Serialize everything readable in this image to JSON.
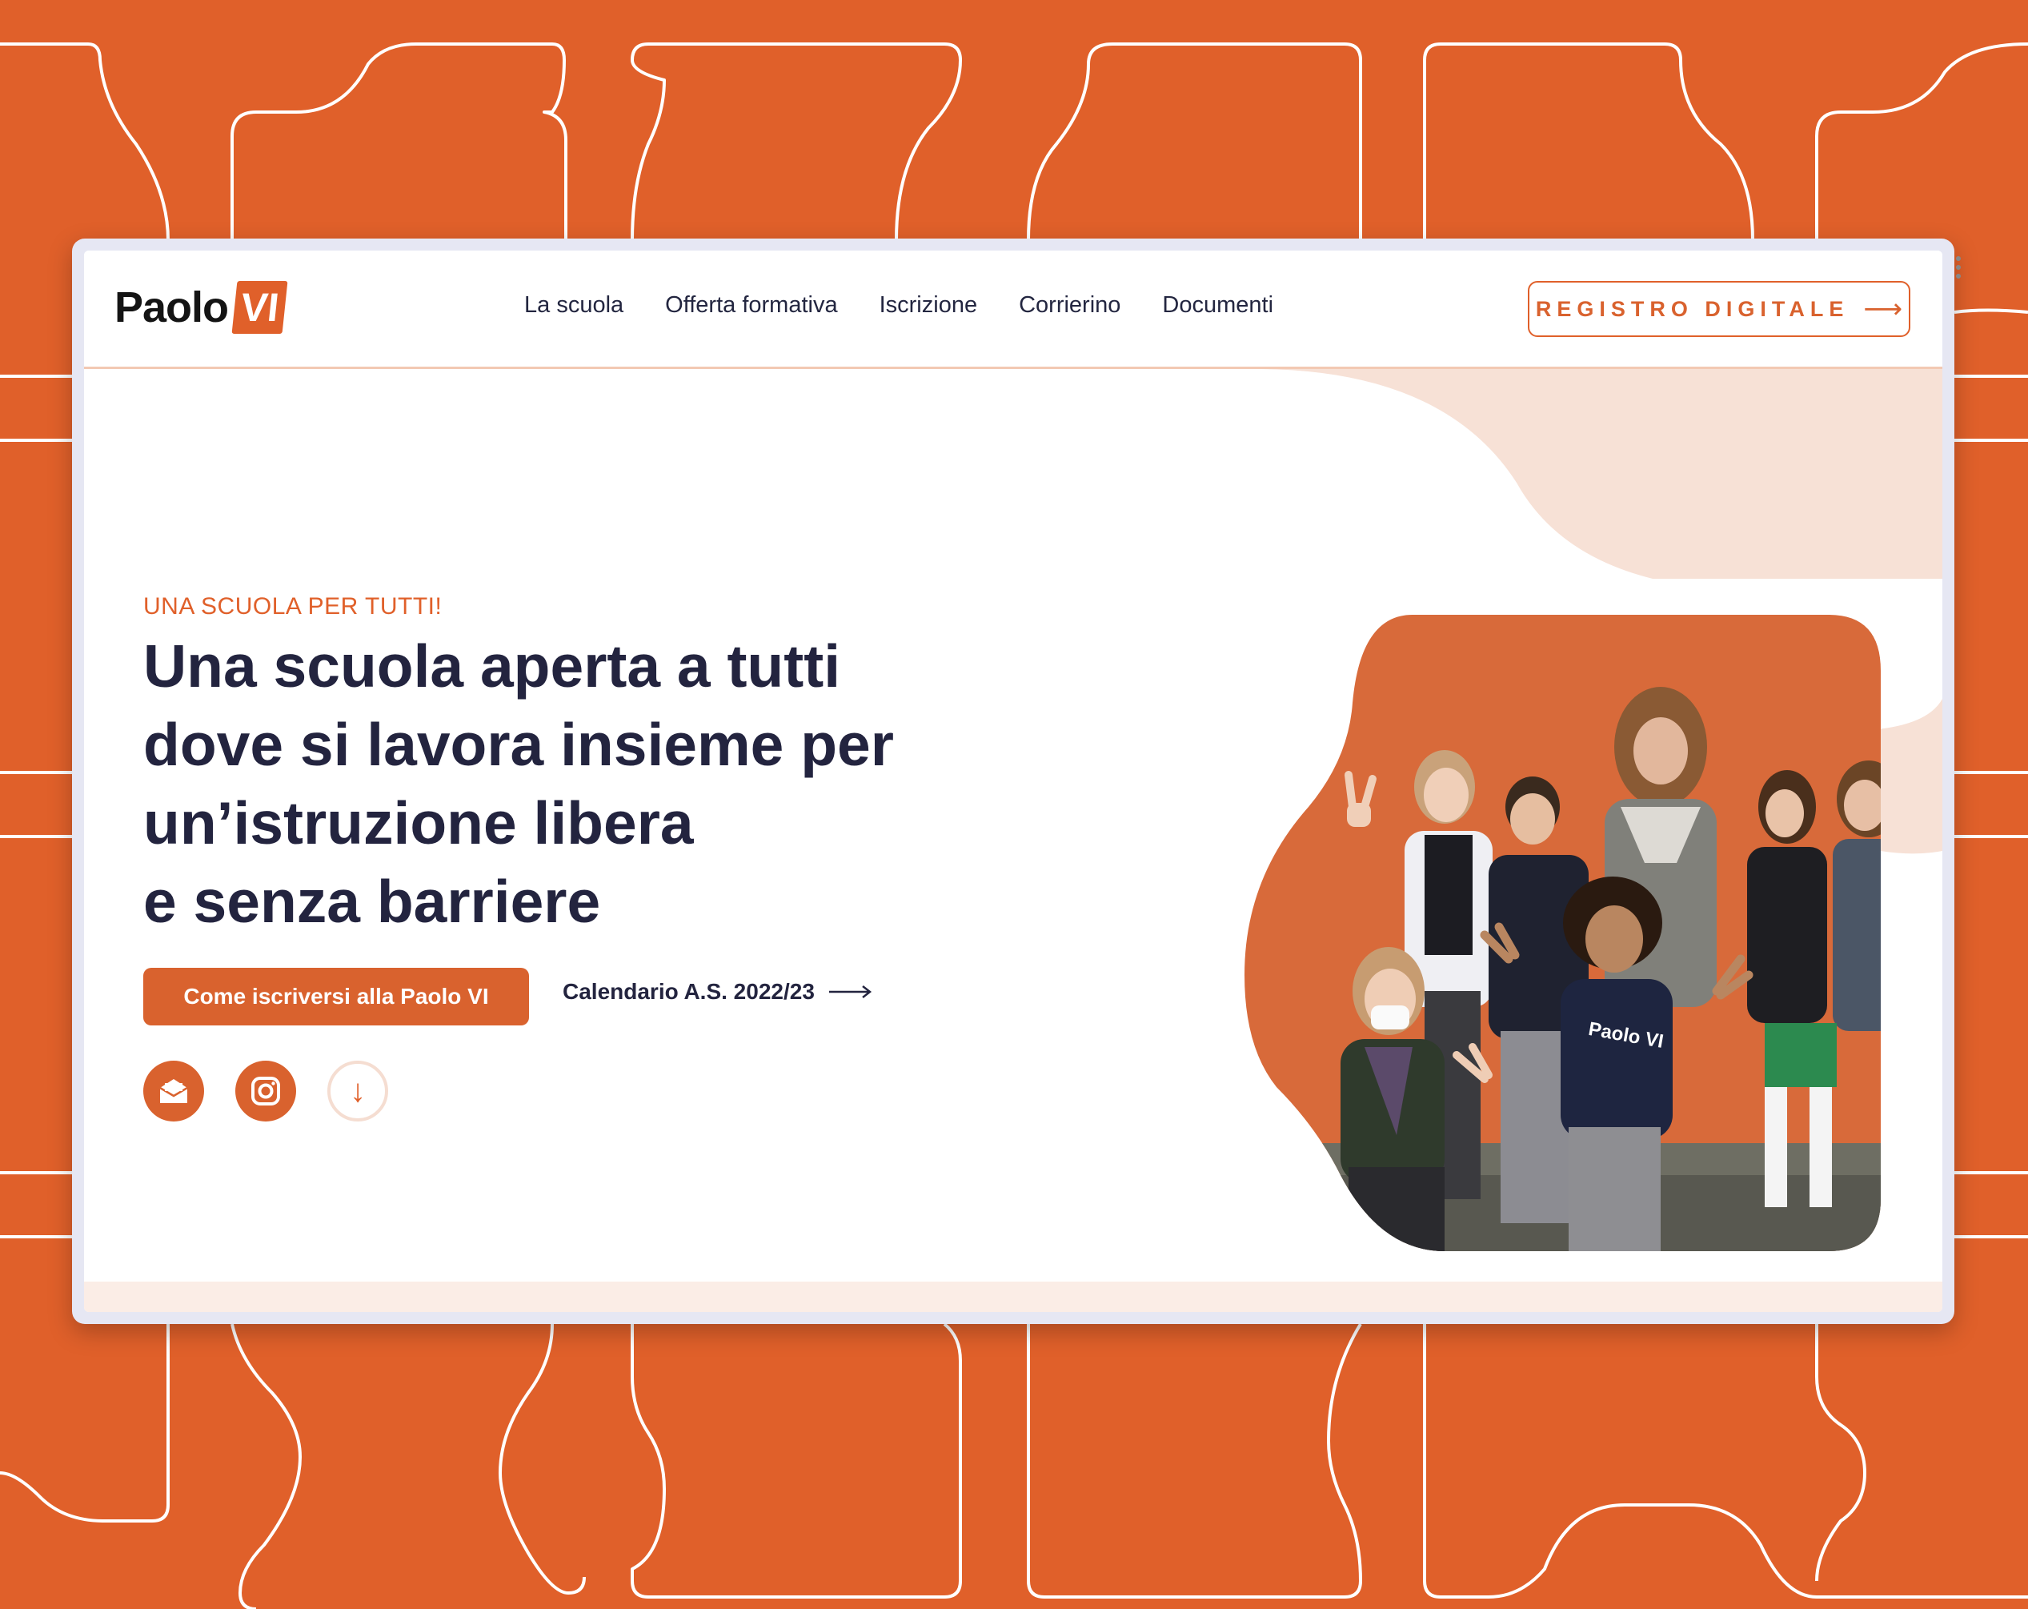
{
  "header": {
    "logo_word": "Paolo",
    "logo_mark": "VI",
    "nav": [
      "La scuola",
      "Offerta formativa",
      "Iscrizione",
      "Corrierino",
      "Documenti"
    ],
    "registro_label": "REGISTRO DIGITALE",
    "registro_arrow": "⟶"
  },
  "hero": {
    "eyebrow": "UNA SCUOLA PER TUTTI!",
    "headline_lines": [
      "Una scuola aperta a tutti",
      "dove si lavora insieme per",
      "un’istruzione libera",
      "e senza barriere"
    ],
    "cta_primary": "Come iscriversi alla Paolo VI",
    "cta_secondary": "Calendario A.S. 2022/23",
    "social_icons": [
      "mail-icon",
      "instagram-icon",
      "arrow-down-icon"
    ],
    "scroll_down_glyph": "↓",
    "tshirt_logo": "Paolo VI"
  },
  "colors": {
    "brand_orange": "#E0602A",
    "dark_navy": "#23243F",
    "soft_peach": "#F7E1D6"
  }
}
